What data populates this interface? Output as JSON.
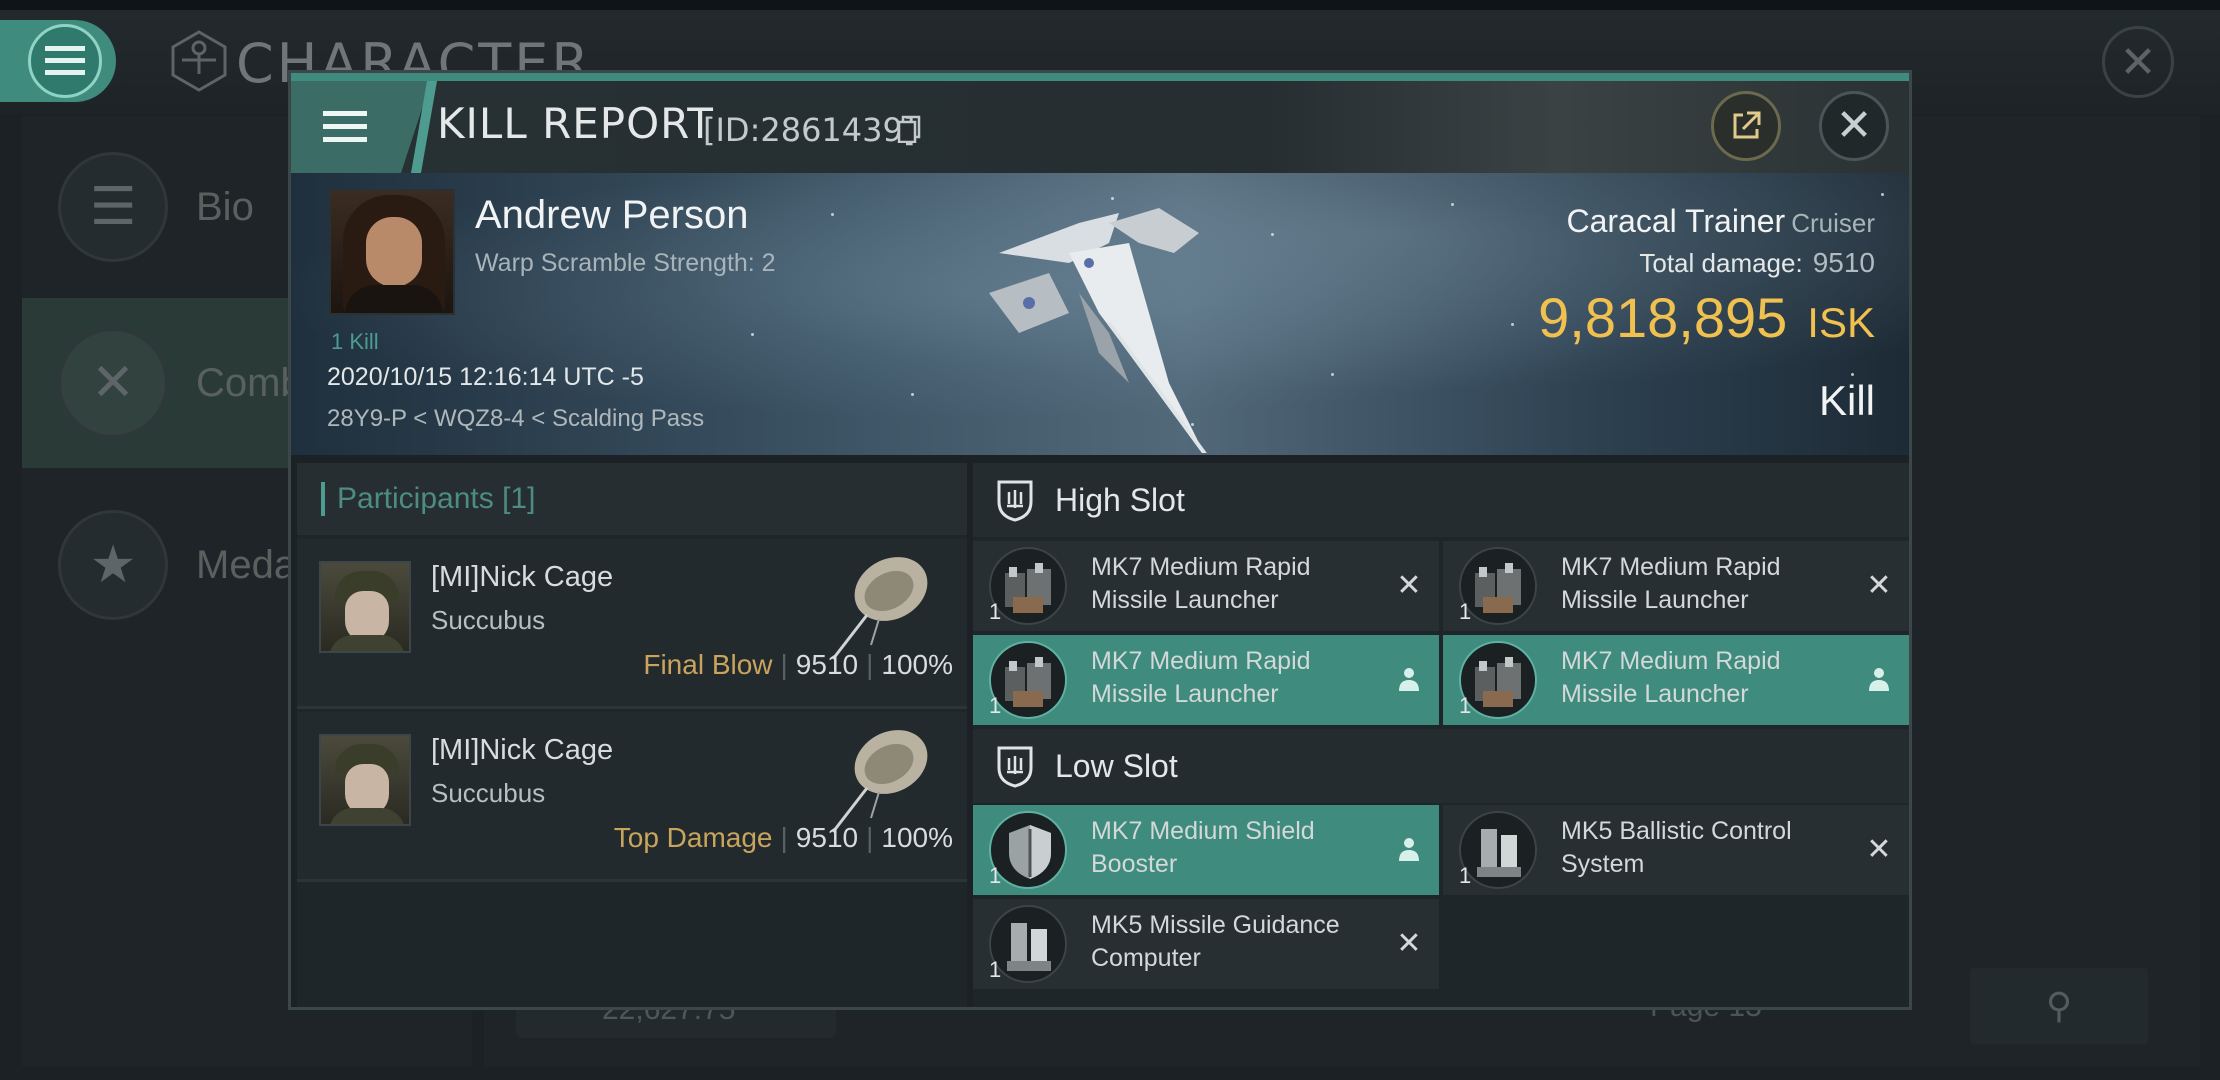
{
  "background": {
    "title": "CHARACTER",
    "sidebar": [
      {
        "label": "Bio",
        "icon": "menu-lines-icon"
      },
      {
        "label": "Comb",
        "icon": "crossed-swords-icon"
      },
      {
        "label": "Meda",
        "icon": "medal-star-icon"
      }
    ],
    "bottom_value": "22,627.75",
    "page_label": "Page 13"
  },
  "modal": {
    "title": "KILL REPORT",
    "id_label": "[ID:2861439]",
    "victim": {
      "name": "Andrew Person",
      "subtitle": "Warp Scramble Strength: 2",
      "kill_count": "1 Kill",
      "datetime": "2020/10/15 12:16:14 UTC -5",
      "location": "28Y9-P < WQZ8-4 < Scalding Pass",
      "ship": "Caracal Trainer",
      "ship_class": "Cruiser",
      "total_damage_label": "Total damage:",
      "total_damage": "9510",
      "isk_value": "9,818,895",
      "isk_unit": "ISK",
      "result": "Kill"
    },
    "participants": {
      "header": "Participants [1]",
      "rows": [
        {
          "name": "[MI]Nick Cage",
          "ship": "Succubus",
          "tag": "Final Blow",
          "damage": "9510",
          "percent": "100%"
        },
        {
          "name": "[MI]Nick Cage",
          "ship": "Succubus",
          "tag": "Top Damage",
          "damage": "9510",
          "percent": "100%"
        }
      ]
    },
    "slots": {
      "high": {
        "label": "High Slot",
        "modules": [
          {
            "name": "MK7 Medium Rapid Missile Launcher",
            "qty": "1",
            "state": "destroyed"
          },
          {
            "name": "MK7 Medium Rapid Missile Launcher",
            "qty": "1",
            "state": "destroyed"
          },
          {
            "name": "MK7 Medium Rapid Missile Launcher",
            "qty": "1",
            "state": "dropped"
          },
          {
            "name": "MK7 Medium Rapid Missile Launcher",
            "qty": "1",
            "state": "dropped"
          }
        ]
      },
      "low": {
        "label": "Low Slot",
        "modules": [
          {
            "name": "MK7 Medium Shield Booster",
            "qty": "1",
            "state": "dropped"
          },
          {
            "name": "MK5 Ballistic Control System",
            "qty": "1",
            "state": "destroyed"
          },
          {
            "name": "MK5 Missile Guidance Computer",
            "qty": "1",
            "state": "destroyed"
          }
        ]
      }
    }
  },
  "colors": {
    "accent": "#3f8c7f",
    "isk": "#f1c150",
    "tag": "#c9a45c"
  }
}
